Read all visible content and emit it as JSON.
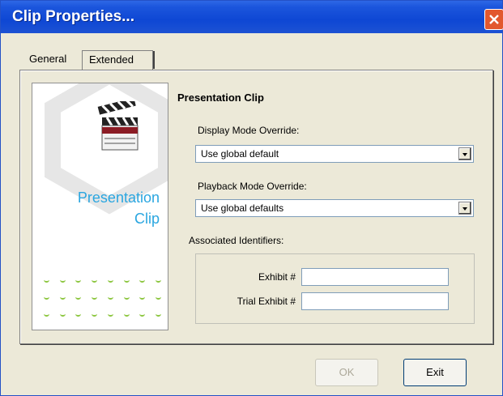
{
  "window": {
    "title": "Clip Properties..."
  },
  "tabs": [
    {
      "label": "General",
      "selected": false
    },
    {
      "label": "Extended",
      "selected": true
    }
  ],
  "image_panel": {
    "line1": "Presentation",
    "line2": "Clip",
    "icon": "clapperboard-icon"
  },
  "form": {
    "heading": "Presentation Clip",
    "display_mode": {
      "label": "Display Mode Override:",
      "value": "Use global default"
    },
    "playback_mode": {
      "label": "Playback Mode Override:",
      "value": "Use global defaults"
    },
    "identifiers": {
      "label": "Associated Identifiers:",
      "exhibit_label": "Exhibit #",
      "exhibit_value": "",
      "trial_exhibit_label": "Trial Exhibit #",
      "trial_exhibit_value": ""
    }
  },
  "buttons": {
    "ok": "OK",
    "exit": "Exit"
  },
  "colors": {
    "title_bar": "#0e47d4",
    "accent_text": "#2aa6e0",
    "dot_green": "#8cc63f",
    "close_button": "#e2582e"
  }
}
